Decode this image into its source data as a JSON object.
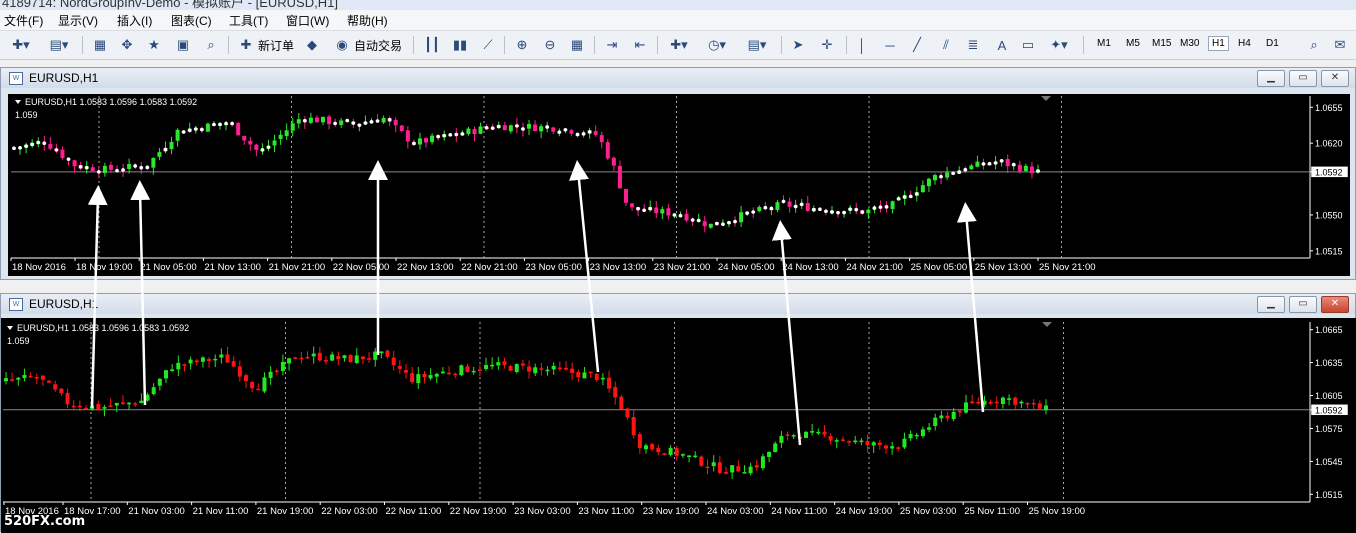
{
  "app": {
    "title_partial": "4189714: NordGroupInv-Demo - 模拟账户 - [EURUSD,H1]"
  },
  "menu": [
    "文件(F)",
    "显示(V)",
    "插入(I)",
    "图表(C)",
    "工具(T)",
    "窗口(W)",
    "帮助(H)"
  ],
  "toolbar": {
    "new_order": "新订单",
    "autotrade": "自动交易",
    "timeframes": [
      "M1",
      "M5",
      "M15",
      "M30",
      "H1",
      "H4",
      "D1"
    ],
    "active_timeframe": "H1"
  },
  "windows": [
    {
      "title": "EURUSD,H1",
      "info": "EURUSD,H1  1.0583 1.0596 1.0583 1.0592",
      "subinfo": "1.059",
      "price_labels": [
        "1.0655",
        "1.0620",
        "1.0592",
        "1.0550",
        "1.0515"
      ],
      "current_price": "1.0592",
      "time_labels": [
        "18 Nov 2016",
        "18 Nov 19:00",
        "21 Nov 05:00",
        "21 Nov 13:00",
        "21 Nov 21:00",
        "22 Nov 05:00",
        "22 Nov 13:00",
        "22 Nov 21:00",
        "23 Nov 05:00",
        "23 Nov 13:00",
        "23 Nov 21:00",
        "24 Nov 05:00",
        "24 Nov 13:00",
        "24 Nov 21:00",
        "25 Nov 05:00",
        "25 Nov 13:00",
        "25 Nov 21:00"
      ],
      "bull_color": "#2ee62e",
      "bear_color": "#ff1f8f",
      "candle_style": "heiken"
    },
    {
      "title": "EURUSD,H1",
      "info": "EURUSD,H1  1.0583 1.0596 1.0583 1.0592",
      "subinfo": "1.059",
      "price_labels": [
        "1.0665",
        "1.0635",
        "1.0605",
        "1.0592",
        "1.0575",
        "1.0545",
        "1.0515"
      ],
      "current_price": "1.0592",
      "time_labels": [
        "18 Nov 2016",
        "18 Nov 17:00",
        "21 Nov 03:00",
        "21 Nov 11:00",
        "21 Nov 19:00",
        "22 Nov 03:00",
        "22 Nov 11:00",
        "22 Nov 19:00",
        "23 Nov 03:00",
        "23 Nov 11:00",
        "23 Nov 19:00",
        "24 Nov 03:00",
        "24 Nov 11:00",
        "24 Nov 19:00",
        "25 Nov 03:00",
        "25 Nov 11:00",
        "25 Nov 19:00"
      ],
      "bull_color": "#22e822",
      "bear_color": "#ff1414",
      "candle_style": "plain"
    }
  ],
  "watermark": "520FX.com"
}
